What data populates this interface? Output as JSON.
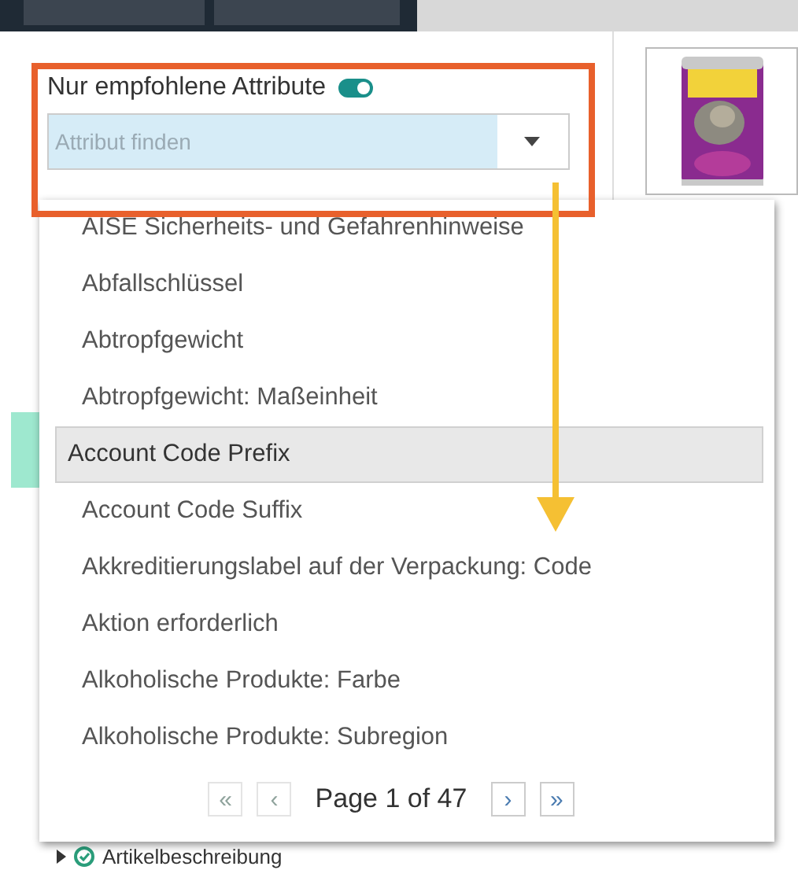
{
  "filter": {
    "label": "Nur empfohlene Attribute",
    "toggle_on": true
  },
  "search": {
    "placeholder": "Attribut finden"
  },
  "options": [
    {
      "label": "AISE Sicherheits- und Gefahrenhinweise",
      "selected": false
    },
    {
      "label": "Abfallschlüssel",
      "selected": false
    },
    {
      "label": "Abtropfgewicht",
      "selected": false
    },
    {
      "label": "Abtropfgewicht: Maßeinheit",
      "selected": false
    },
    {
      "label": "Account Code Prefix",
      "selected": true
    },
    {
      "label": "Account Code Suffix",
      "selected": false
    },
    {
      "label": "Akkreditierungslabel auf der Verpackung: Code",
      "selected": false
    },
    {
      "label": "Aktion erforderlich",
      "selected": false
    },
    {
      "label": "Alkoholische Produkte: Farbe",
      "selected": false
    },
    {
      "label": "Alkoholische Produkte: Subregion",
      "selected": false
    }
  ],
  "pagination": {
    "buttons": [
      {
        "glyph": "«",
        "disabled": true
      },
      {
        "glyph": "‹",
        "disabled": true
      },
      {
        "glyph": "›",
        "disabled": false
      },
      {
        "glyph": "»",
        "disabled": false
      }
    ],
    "page_text": "Page 1 of 47"
  },
  "section": {
    "label": "Artikelbeschreibung"
  }
}
